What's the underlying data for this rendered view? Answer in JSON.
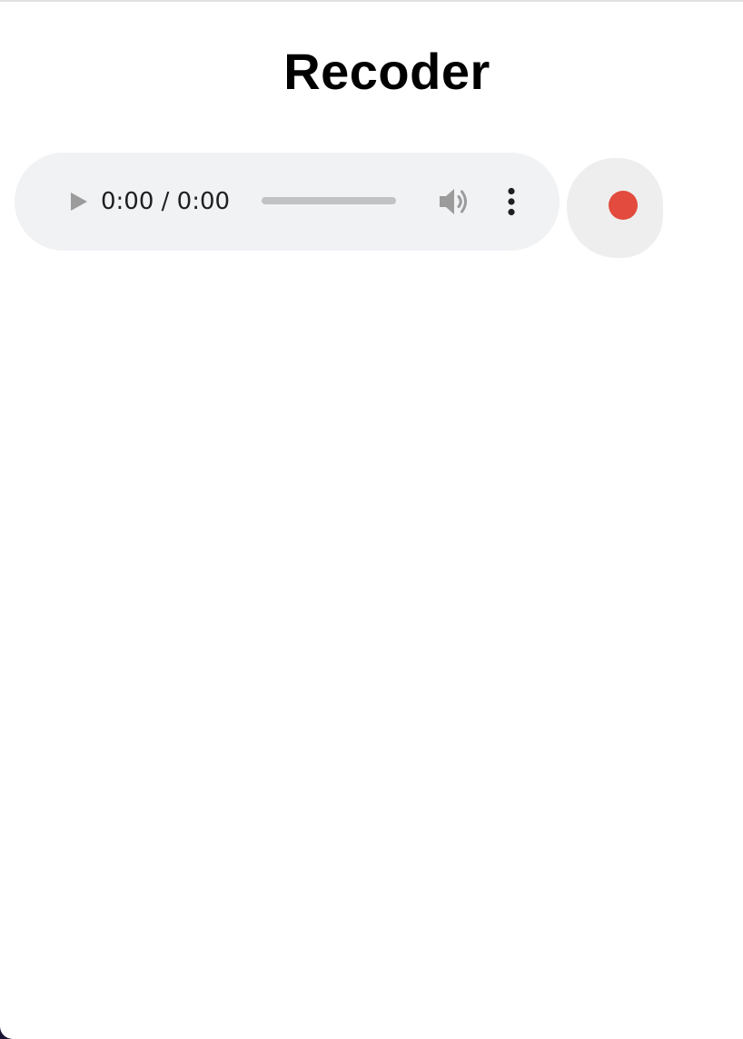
{
  "app": {
    "title": "Recoder"
  },
  "player": {
    "time_display": "0:00 / 0:00",
    "progress_fraction": 0,
    "play_icon": "play-icon",
    "volume_icon": "volume-icon",
    "more_icon": "more-vertical-icon"
  },
  "record": {
    "icon": "record-dot-icon",
    "dot_color": "#e24b3d",
    "button_bg": "#eeeeee"
  },
  "colors": {
    "background": "#ffffff",
    "player_bg": "#f1f2f4",
    "icon_gray": "#9b9b9b",
    "text": "#1f1f1f"
  }
}
